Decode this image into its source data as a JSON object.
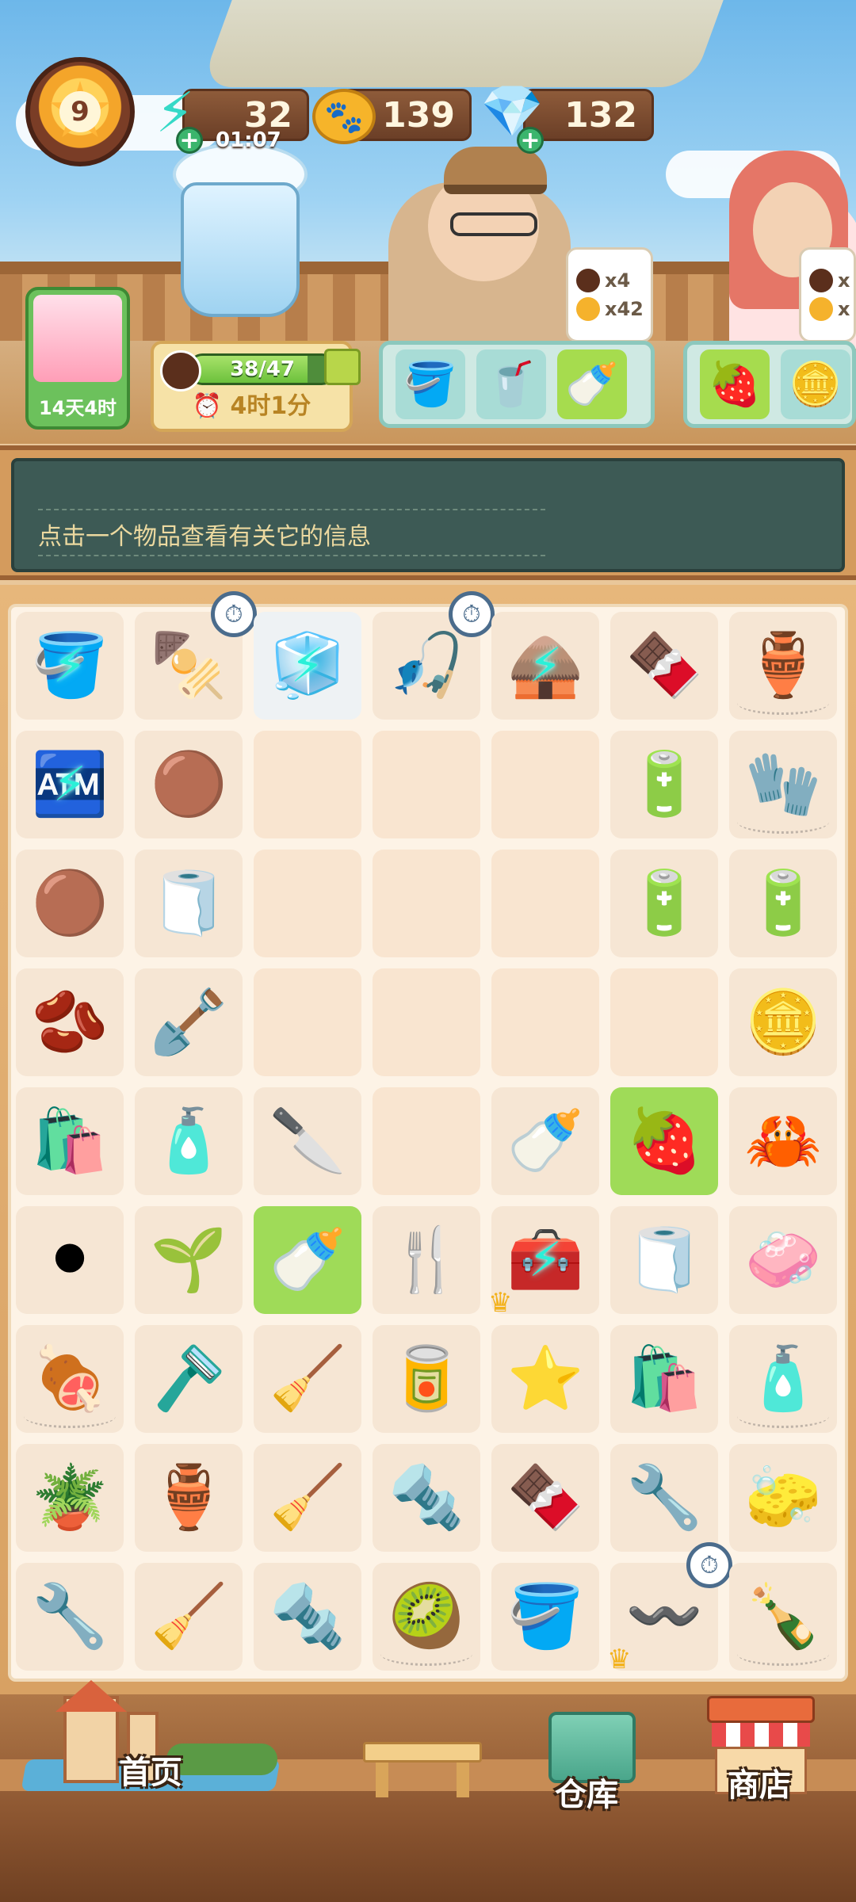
{
  "player": {
    "level": "9",
    "event_timer": "14天4时"
  },
  "resources": {
    "energy": {
      "value": "32",
      "timer": "01:07",
      "icon": "lightning-bolt-icon"
    },
    "paws": {
      "value": "139",
      "icon": "paw-coin-icon"
    },
    "gems": {
      "value": "132",
      "icon": "diamond-gem-icon"
    }
  },
  "order_progress": {
    "progress_text": "38/47",
    "progress_fraction": 0.809,
    "timer": "4时1分"
  },
  "customers": [
    {
      "name": "detective-man",
      "reward_choco": "x4",
      "reward_paw": "x42",
      "items": [
        "pink-bucket",
        "red-drink-cup",
        "milk-bottle"
      ],
      "ready_index": 2
    },
    {
      "name": "red-haired-woman",
      "reward_choco": "x",
      "reward_paw": "x",
      "items": [
        "strawberry-drink",
        "coin-stack"
      ],
      "ready_index": 0
    }
  ],
  "info": {
    "text": "点击一个物品查看有关它的信息"
  },
  "grid": {
    "rows": [
      [
        {
          "item": "wooden-bucket",
          "icon": "🪣",
          "bolt": true
        },
        {
          "item": "grill",
          "icon": "🍢",
          "clock": true
        },
        {
          "item": "glass-case",
          "icon": "🧊",
          "bolt": true,
          "frozen": true
        },
        {
          "item": "fishing-rod",
          "icon": "🎣",
          "clock": true
        },
        {
          "item": "straw-hut",
          "icon": "🛖",
          "bolt": true
        },
        {
          "item": "chocolate-bar",
          "icon": "🍫"
        },
        {
          "item": "pot",
          "icon": "🏺",
          "web": true
        }
      ],
      [
        {
          "item": "vending-machine",
          "icon": "🏧",
          "bolt": true
        },
        {
          "item": "chocolate-ball",
          "icon": "🟤"
        },
        {
          "item": "",
          "empty": true
        },
        {
          "item": "",
          "empty": true
        },
        {
          "item": "",
          "empty": true
        },
        {
          "item": "battery-small",
          "icon": "🔋"
        },
        {
          "item": "glove",
          "icon": "🧤",
          "web": true
        }
      ],
      [
        {
          "item": "chocolate-balls",
          "icon": "🟤"
        },
        {
          "item": "towel",
          "icon": "🧻"
        },
        {
          "item": "",
          "empty": true
        },
        {
          "item": "",
          "empty": true
        },
        {
          "item": "",
          "empty": true
        },
        {
          "item": "battery",
          "icon": "🔋"
        },
        {
          "item": "battery-large",
          "icon": "🔋"
        }
      ],
      [
        {
          "item": "seed",
          "icon": "🫘"
        },
        {
          "item": "shovel",
          "icon": "🪏"
        },
        {
          "item": "",
          "empty": true
        },
        {
          "item": "",
          "empty": true
        },
        {
          "item": "",
          "empty": true
        },
        {
          "item": "",
          "empty": true
        },
        {
          "item": "battery-coin",
          "icon": "🪙"
        }
      ],
      [
        {
          "item": "snack-bag",
          "icon": "🛍️"
        },
        {
          "item": "toothpaste",
          "icon": "🧴"
        },
        {
          "item": "trowel",
          "icon": "🔪"
        },
        {
          "item": "",
          "empty": true
        },
        {
          "item": "milk-bottle",
          "icon": "🍼"
        },
        {
          "item": "strawberry-drink",
          "icon": "🍓",
          "hl": true
        },
        {
          "item": "crab",
          "icon": "🦀"
        }
      ],
      [
        {
          "item": "go-board",
          "icon": "⚫"
        },
        {
          "item": "sprout",
          "icon": "🌱"
        },
        {
          "item": "milk-bottle",
          "icon": "🍼",
          "hl": true
        },
        {
          "item": "fork",
          "icon": "🍴"
        },
        {
          "item": "tool-box",
          "icon": "🧰",
          "bolt": true,
          "crown": true
        },
        {
          "item": "towel",
          "icon": "🧻"
        },
        {
          "item": "soap",
          "icon": "🧼"
        }
      ],
      [
        {
          "item": "meatballs",
          "icon": "🍖",
          "web": true
        },
        {
          "item": "scraper",
          "icon": "🪒"
        },
        {
          "item": "broom",
          "icon": "🧹"
        },
        {
          "item": "tin-can",
          "icon": "🥫"
        },
        {
          "item": "starfish",
          "icon": "⭐"
        },
        {
          "item": "plastic-bag",
          "icon": "🛍️"
        },
        {
          "item": "detergent",
          "icon": "🧴",
          "web": true
        }
      ],
      [
        {
          "item": "potted-plant",
          "icon": "🪴"
        },
        {
          "item": "vase",
          "icon": "🏺"
        },
        {
          "item": "dustpan",
          "icon": "🧹"
        },
        {
          "item": "hex-nut",
          "icon": "🔩"
        },
        {
          "item": "choco-sticks",
          "icon": "🍫"
        },
        {
          "item": "pipe",
          "icon": "🔧"
        },
        {
          "item": "yellow-towel",
          "icon": "🧽"
        }
      ],
      [
        {
          "item": "pipe-fittings",
          "icon": "🔧"
        },
        {
          "item": "dustpan",
          "icon": "🧹"
        },
        {
          "item": "screw",
          "icon": "🔩"
        },
        {
          "item": "kiwi-bowl",
          "icon": "🥝",
          "web": true
        },
        {
          "item": "watering-can",
          "icon": "🪣"
        },
        {
          "item": "tangled-wire",
          "icon": "〰️",
          "clock": true,
          "crown": true
        },
        {
          "item": "bottle-weeds",
          "icon": "🍾",
          "web": true
        }
      ]
    ]
  },
  "nav": {
    "home_label": "首页",
    "warehouse_label": "仓库",
    "shop_label": "商店"
  },
  "colors": {
    "highlight_cell": "#9fdb58",
    "empty_cell": "#f9e5d0",
    "info_panel": "#3d5a55",
    "info_text": "#ecd9a0",
    "bolt": "#2af0d8"
  }
}
